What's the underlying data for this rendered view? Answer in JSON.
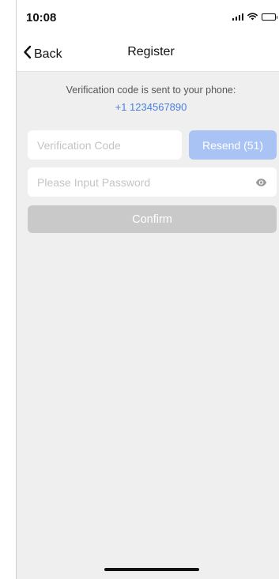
{
  "status_bar": {
    "time": "10:08"
  },
  "nav": {
    "back_label": "Back",
    "title": "Register"
  },
  "info": {
    "message": "Verification code is sent to your phone:",
    "phone": "+1 1234567890"
  },
  "form": {
    "code_placeholder": "Verification Code",
    "code_value": "",
    "resend_label": "Resend (51)",
    "password_placeholder": "Please Input Password",
    "password_value": "",
    "confirm_label": "Confirm"
  },
  "icons": {
    "back": "chevron-left-icon",
    "visibility": "eye-icon",
    "signal": "signal-icon",
    "wifi": "wifi-icon",
    "battery": "battery-icon"
  },
  "colors": {
    "accent": "#4a7fdc",
    "resend_bg": "#a9c4f4",
    "confirm_disabled": "#c9c9c9",
    "background": "#efefef"
  }
}
